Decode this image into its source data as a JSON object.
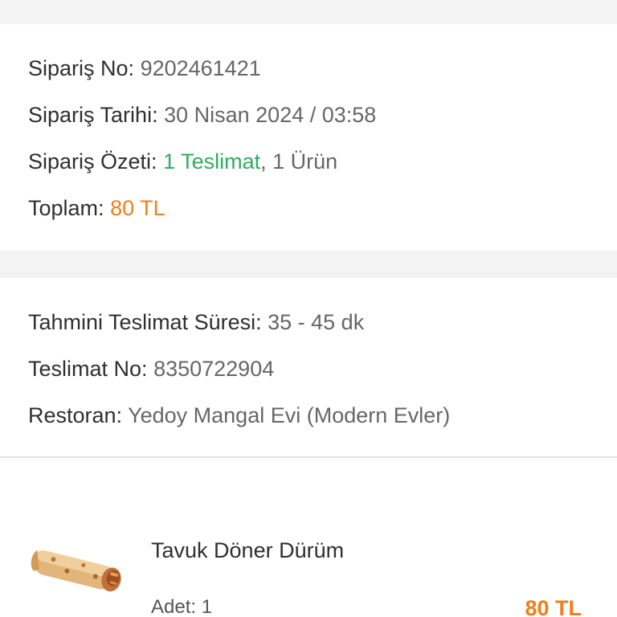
{
  "order": {
    "no_label": "Sipariş No:",
    "no_value": "9202461421",
    "date_label": "Sipariş Tarihi:",
    "date_value": "30 Nisan 2024 / 03:58",
    "summary_label": "Sipariş Özeti:",
    "summary_deliveries": "1 Teslimat",
    "summary_items": ", 1 Ürün",
    "total_label": "Toplam:",
    "total_value": "80 TL"
  },
  "delivery": {
    "eta_label": "Tahmini Teslimat Süresi:",
    "eta_value": "35 - 45 dk",
    "no_label": "Teslimat No:",
    "no_value": "8350722904",
    "restaurant_label": "Restoran:",
    "restaurant_value": "Yedoy Mangal Evi (Modern Evler)"
  },
  "items": [
    {
      "name": "Tavuk Döner Dürüm",
      "qty": "Adet: 1",
      "price": "80 TL",
      "image": "chicken-doner-wrap-image"
    }
  ],
  "colors": {
    "accent_orange": "#f07f1a",
    "accent_green": "#2eae5c",
    "background": "#f3f3f4"
  }
}
